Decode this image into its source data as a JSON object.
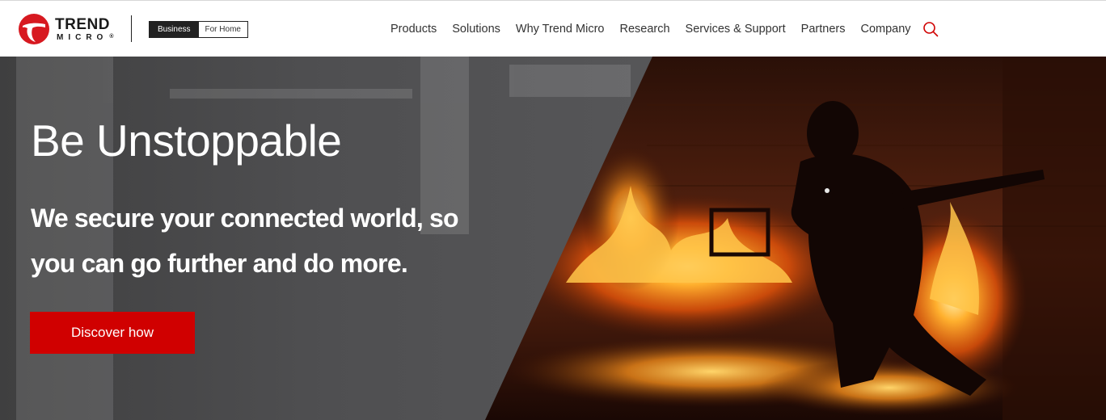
{
  "brand": {
    "name_line1": "TREND",
    "name_line2": "MICRO",
    "trademark": "®",
    "accent_color": "#d00000",
    "icon": "trend-micro-logo-icon"
  },
  "segment": {
    "business_label": "Business",
    "home_label": "For Home",
    "selected": "Business"
  },
  "nav": {
    "items": [
      {
        "label": "Products"
      },
      {
        "label": "Solutions"
      },
      {
        "label": "Why Trend Micro"
      },
      {
        "label": "Research"
      },
      {
        "label": "Services & Support"
      },
      {
        "label": "Partners"
      },
      {
        "label": "Company"
      }
    ],
    "search_icon": "search-icon"
  },
  "hero": {
    "title": "Be Unstoppable",
    "subtitle": "We secure your connected world, so you can go further and do more.",
    "cta_label": "Discover how",
    "cta_color": "#d00000"
  }
}
